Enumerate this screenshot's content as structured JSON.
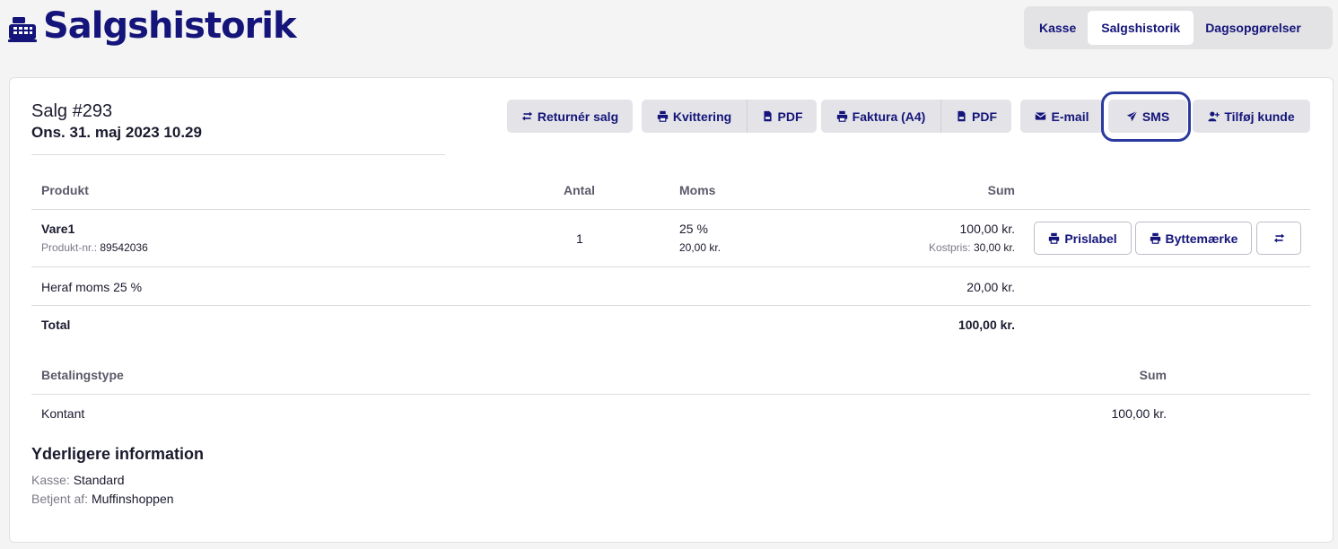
{
  "header": {
    "title": "Salgshistorik",
    "icon": "cash-register-icon",
    "nav": [
      {
        "label": "Kasse",
        "active": false
      },
      {
        "label": "Salgshistorik",
        "active": true
      },
      {
        "label": "Dagsopgørelser",
        "active": false
      }
    ]
  },
  "sale": {
    "title": "Salg #293",
    "date": "Ons. 31. maj 2023 10.29"
  },
  "actions": {
    "return_sale": "Returnér salg",
    "receipt": "Kvittering",
    "receipt_pdf": "PDF",
    "invoice": "Faktura (A4)",
    "invoice_pdf": "PDF",
    "email": "E-mail",
    "sms": "SMS",
    "add_customer": "Tilføj kunde"
  },
  "products_table": {
    "headers": {
      "product": "Produkt",
      "qty": "Antal",
      "vat": "Moms",
      "sum": "Sum"
    },
    "rows": [
      {
        "name": "Vare1",
        "product_no_label": "Produkt-nr.:",
        "product_no": "89542036",
        "qty": "1",
        "vat_rate": "25 %",
        "vat_amount": "20,00 kr.",
        "sum": "100,00 kr.",
        "cost_label": "Kostpris:",
        "cost": "30,00 kr.",
        "price_label_btn": "Prislabel",
        "exchange_label_btn": "Byttemærke"
      }
    ],
    "vat_line": {
      "label": "Heraf moms 25 %",
      "value": "20,00 kr."
    },
    "total": {
      "label": "Total",
      "value": "100,00 kr."
    }
  },
  "payments_table": {
    "headers": {
      "type": "Betalingstype",
      "sum": "Sum"
    },
    "rows": [
      {
        "type": "Kontant",
        "sum": "100,00 kr."
      }
    ]
  },
  "additional": {
    "title": "Yderligere information",
    "register_label": "Kasse:",
    "register_value": "Standard",
    "served_label": "Betjent af:",
    "served_value": "Muffinshoppen"
  },
  "colors": {
    "brand": "#14147a",
    "button_bg": "#e4e4e8",
    "highlight_ring": "#2a3a9e"
  }
}
